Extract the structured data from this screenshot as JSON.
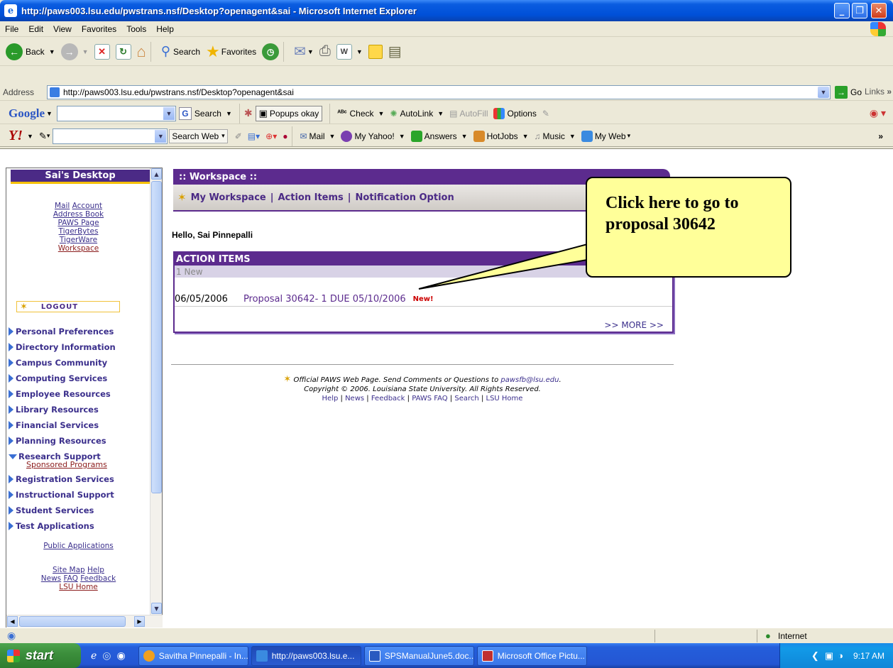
{
  "window": {
    "title": "http://paws003.lsu.edu/pwstrans.nsf/Desktop?openagent&sai - Microsoft Internet Explorer"
  },
  "menu": [
    "File",
    "Edit",
    "View",
    "Favorites",
    "Tools",
    "Help"
  ],
  "toolbar": {
    "back": "Back",
    "search": "Search",
    "favorites": "Favorites"
  },
  "address": {
    "label": "Address",
    "url": "http://paws003.lsu.edu/pwstrans.nsf/Desktop?openagent&sai",
    "go": "Go",
    "links": "Links"
  },
  "google": {
    "logo": "Google",
    "search": "Search",
    "popups": "Popups okay",
    "check": "Check",
    "autolink": "AutoLink",
    "autofill": "AutoFill",
    "options": "Options"
  },
  "yahoo": {
    "logo": "Y!",
    "search_web": "Search Web",
    "mail": "Mail",
    "my_yahoo": "My Yahoo!",
    "answers": "Answers",
    "hotjobs": "HotJobs",
    "music": "Music",
    "my_web": "My Web"
  },
  "sidebar": {
    "title": "Sai's Desktop",
    "links1": [
      "Mail",
      "Account"
    ],
    "links2": [
      "Address Book",
      "PAWS Page",
      "TigerBytes",
      "TigerWare",
      "Workspace"
    ],
    "logout": "LOGOUT",
    "nav": [
      "Personal Preferences",
      "Directory Information",
      "Campus Community",
      "Computing Services",
      "Employee Resources",
      "Library Resources",
      "Financial Services",
      "Planning Resources",
      "Research Support",
      "Registration Services",
      "Instructional Support",
      "Student Services",
      "Test Applications"
    ],
    "sub_item": "Sponsored Programs",
    "public_apps": "Public Applications",
    "bottom_links1": [
      "Site Map",
      "Help"
    ],
    "bottom_links2": [
      "News",
      "FAQ",
      "Feedback"
    ],
    "lsu_home": "LSU Home"
  },
  "main": {
    "workspace_title": ":: Workspace ::",
    "ws_nav": [
      "My Workspace",
      "Action Items",
      "Notification Option"
    ],
    "hello": "Hello, Sai Pinnepalli",
    "action_items": {
      "header": "ACTION ITEMS",
      "subheader": "1 New",
      "row_date": "06/05/2006",
      "row_link": "Proposal 30642- 1 DUE 05/10/2006",
      "row_badge": "New!",
      "more": ">> MORE >>"
    },
    "footer": {
      "line1_prefix": "Official PAWS Web Page. Send Comments or Questions to ",
      "email": "pawsfb@lsu.edu",
      "line1_suffix": ".",
      "line2": "Copyright © 2006. Louisiana State University. All Rights Reserved.",
      "links": [
        "Help",
        "News",
        "Feedback",
        "PAWS FAQ",
        "Search",
        "LSU Home"
      ]
    }
  },
  "callout": {
    "text": "Click here to go to proposal 30642"
  },
  "statusbar": {
    "zone": "Internet"
  },
  "taskbar": {
    "start": "start",
    "tasks": [
      "Savitha Pinnepalli - In...",
      "http://paws003.lsu.e...",
      "SPSManualJune5.doc...",
      "Microsoft Office Pictu..."
    ],
    "time": "9:17 AM"
  }
}
